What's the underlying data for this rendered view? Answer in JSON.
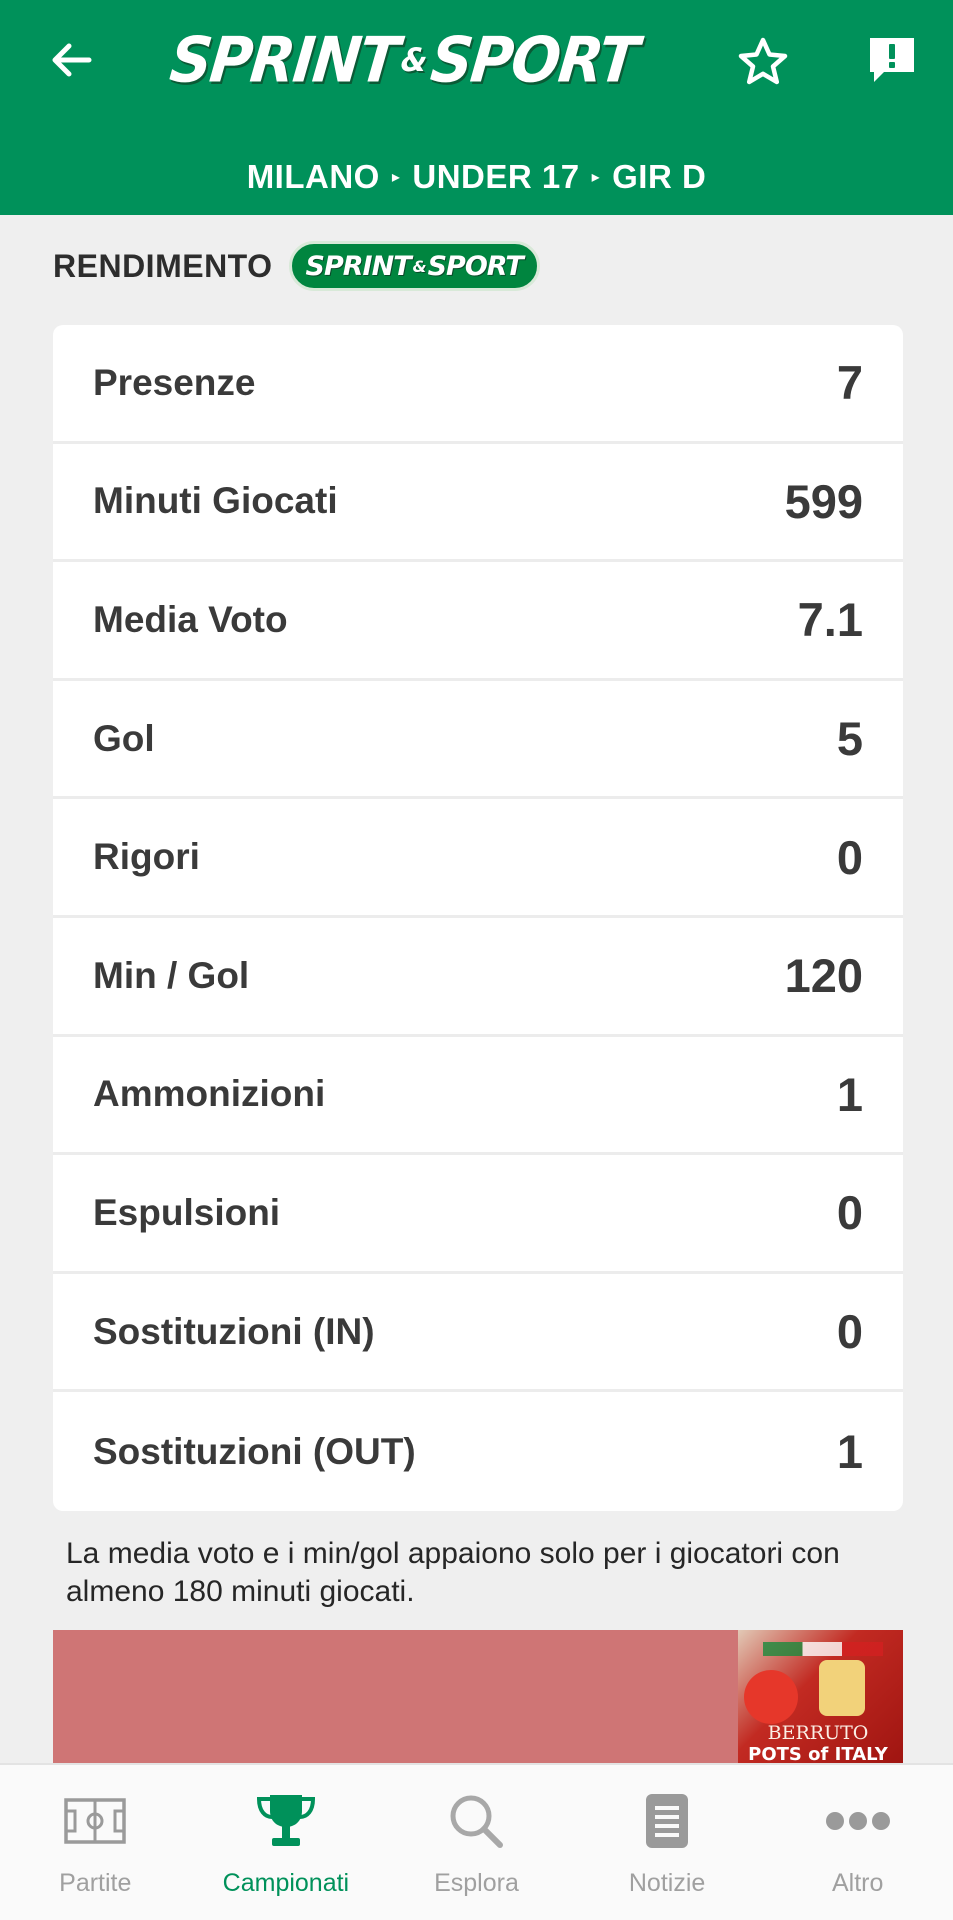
{
  "header": {
    "logo_left": "SPRINT",
    "logo_amp": "&",
    "logo_right": "SPORT",
    "breadcrumb": [
      "MILANO",
      "UNDER 17",
      "GIR D"
    ],
    "breadcrumb_separator": "▸",
    "icons": {
      "back": "arrow-left-icon",
      "favorite": "star-icon",
      "report": "alert-bubble-icon"
    }
  },
  "section": {
    "title": "RENDIMENTO",
    "badge_left": "SPRINT",
    "badge_amp": "&",
    "badge_right": "SPORT"
  },
  "stats": [
    {
      "label": "Presenze",
      "value": "7"
    },
    {
      "label": "Minuti Giocati",
      "value": "599"
    },
    {
      "label": "Media Voto",
      "value": "7.1"
    },
    {
      "label": "Gol",
      "value": "5"
    },
    {
      "label": "Rigori",
      "value": "0"
    },
    {
      "label": "Min / Gol",
      "value": "120"
    },
    {
      "label": "Ammonizioni",
      "value": "1"
    },
    {
      "label": "Espulsioni",
      "value": "0"
    },
    {
      "label": "Sostituzioni (IN)",
      "value": "0"
    },
    {
      "label": "Sostituzioni (OUT)",
      "value": "1"
    }
  ],
  "note": "La media voto e i min/gol appaiono solo per i giocatori con almeno 180 minuti giocati.",
  "ad": {
    "brand": "BERRUTO",
    "product": "POTS of ITALY"
  },
  "nav": {
    "items": [
      {
        "label": "Partite",
        "icon": "pitch-icon",
        "active": false
      },
      {
        "label": "Campionati",
        "icon": "trophy-icon",
        "active": true
      },
      {
        "label": "Esplora",
        "icon": "search-icon",
        "active": false
      },
      {
        "label": "Notizie",
        "icon": "news-icon",
        "active": false
      },
      {
        "label": "Altro",
        "icon": "more-icon",
        "active": false
      }
    ]
  },
  "colors": {
    "brand_green": "#00915a",
    "inactive_gray": "#a0a0a0",
    "text_dark": "#3a3a3a"
  }
}
